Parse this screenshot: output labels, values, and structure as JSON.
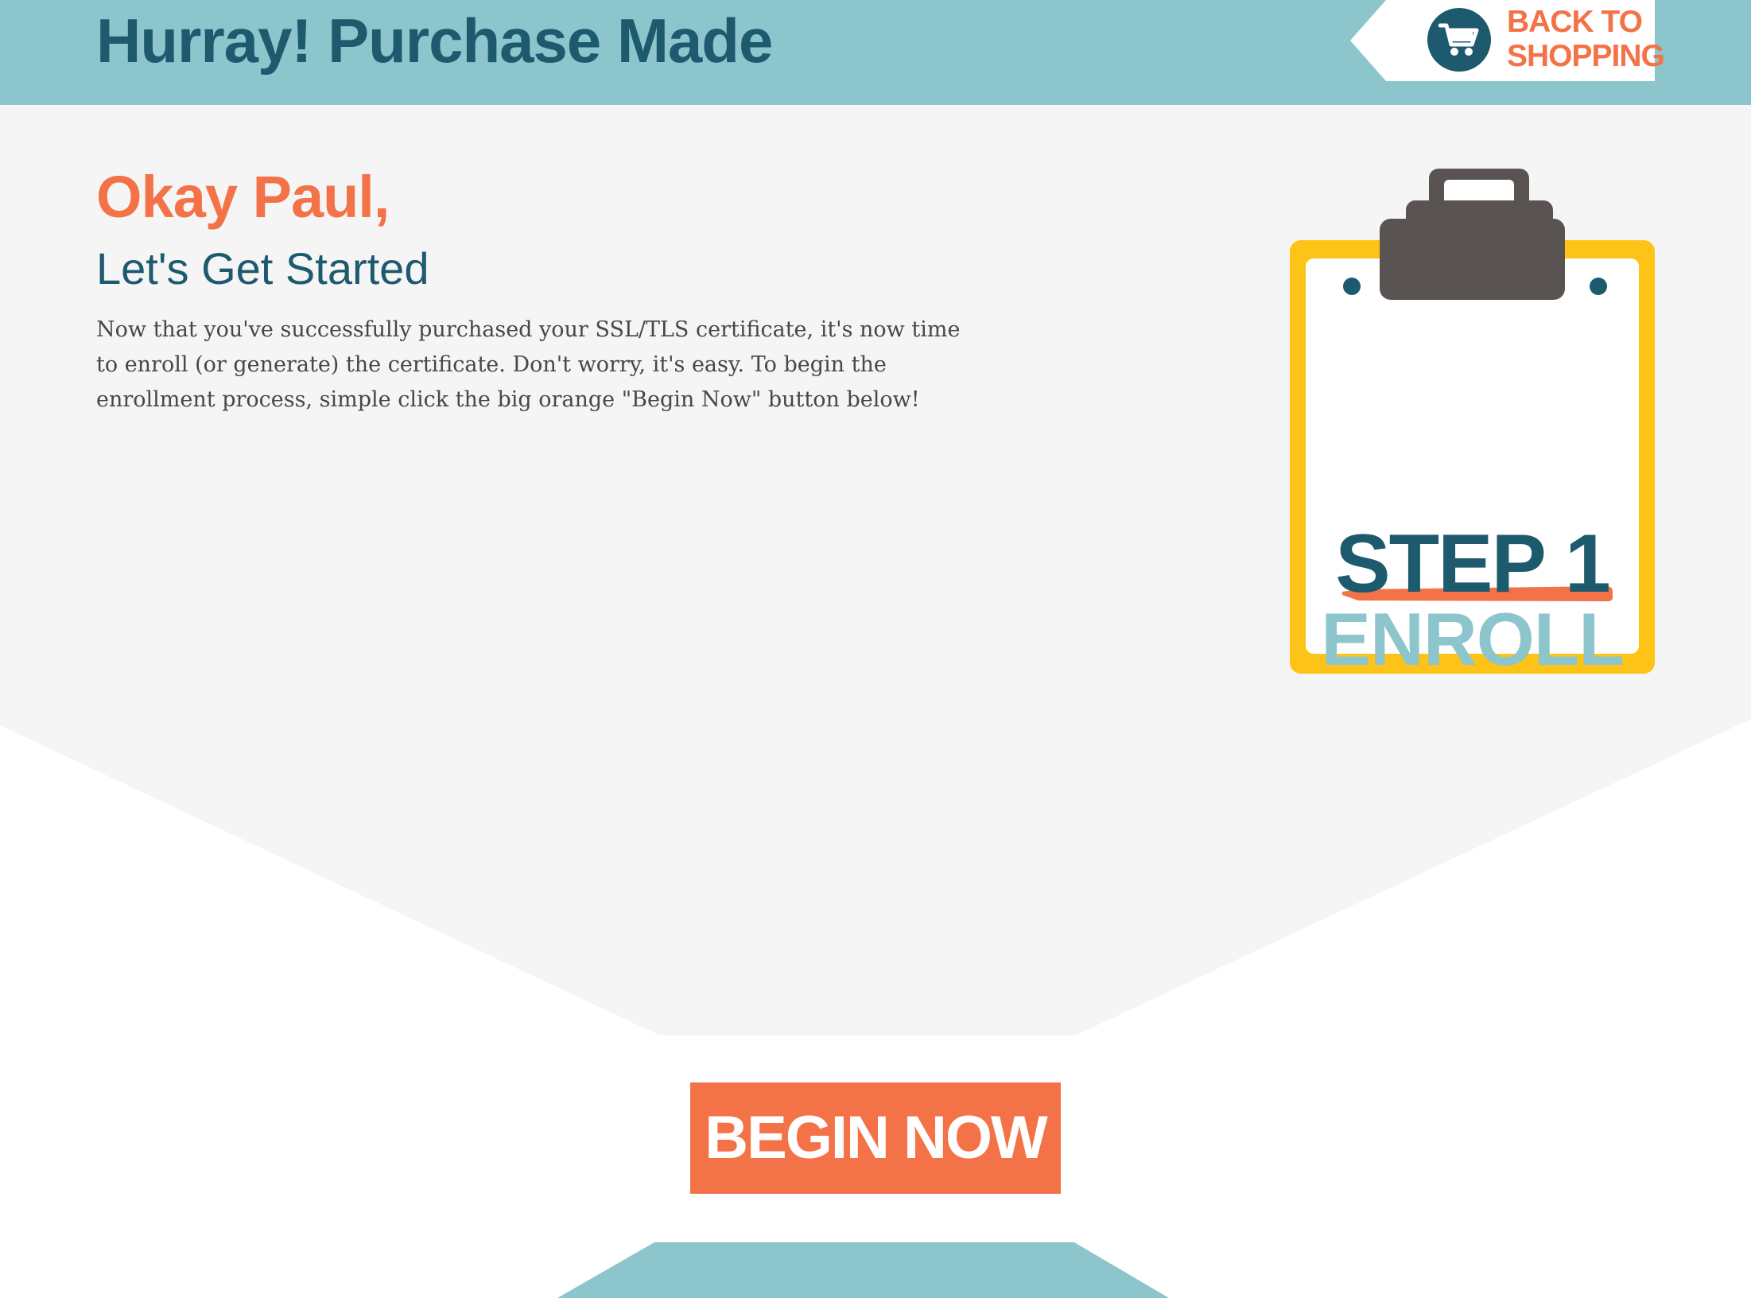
{
  "header": {
    "title": "Hurray! Purchase Made",
    "back_button": {
      "label": "BACK TO\nSHOPPING",
      "icon": "shopping-cart-icon"
    }
  },
  "main": {
    "greeting": "Okay Paul,",
    "subheading": "Let's Get Started",
    "body": "Now that you've successfully purchased your SSL/TLS certificate, it's now time to enroll (or generate) the certificate. Don't worry, it's easy. To begin the enrollment process, simple click the big orange \"Begin Now\" button below!"
  },
  "clipboard": {
    "step_title": "STEP 1",
    "step_subtitle": "ENROLL",
    "icon": "clipboard-icon"
  },
  "cta": {
    "label": "BEGIN NOW"
  },
  "colors": {
    "header_bg": "#8cc5cc",
    "primary_dark": "#1d5a6e",
    "accent_orange": "#f47247",
    "clipboard_frame": "#fdc316",
    "clip_dark": "#595451",
    "page_bg": "#f5f5f5"
  }
}
